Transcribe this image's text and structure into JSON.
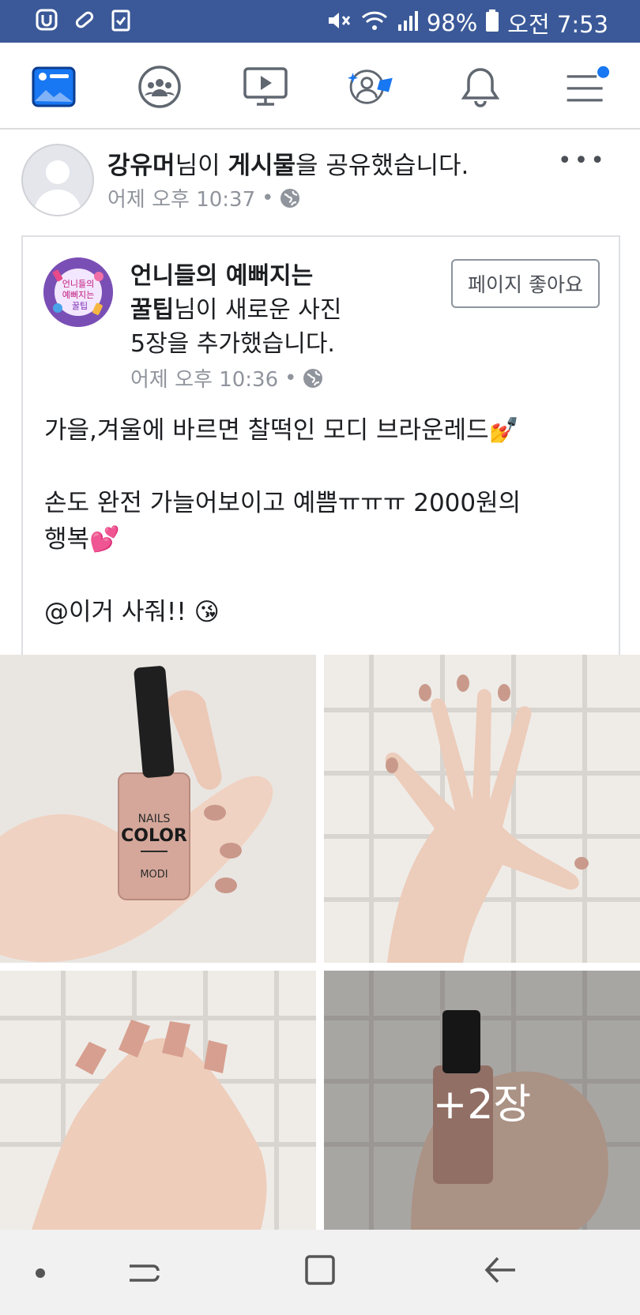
{
  "status_bar": {
    "battery": "98%",
    "time": "오전 7:53"
  },
  "nav": {
    "items": [
      "news-feed",
      "groups",
      "watch",
      "profile",
      "notifications",
      "menu"
    ]
  },
  "post": {
    "user": "강유머",
    "title_suffix": "님이 ",
    "title_object": "게시물",
    "title_end": "을 공유했습니다.",
    "time": "어제 오후 10:37",
    "dot": "•",
    "more": "•••"
  },
  "shared": {
    "page_name": "언니들의 예뻐지는 꿀팁",
    "page_name_line1": "언니들의 예뻐지는",
    "page_name_line2": "꿀팁",
    "action_a": "님이 새로운 사진",
    "action_b": "5장을 추가했습니다.",
    "like_button": "페이지 좋아요",
    "time": "어제 오후 10:36",
    "dot": "•",
    "text_line1": "가을,겨울에 바르면 찰떡인 모디 브라운레드💅",
    "text_line2": "손도 완전 가늘어보이고 예쁨ㅠㅠㅠ 2000원의",
    "text_line3": "행복💕",
    "text_line4": "@이거 사줘!! 😘",
    "more_photos": "+2장"
  },
  "nail_label": {
    "nails": "NAILS",
    "color": "COLOR",
    "brand": "MODI"
  }
}
